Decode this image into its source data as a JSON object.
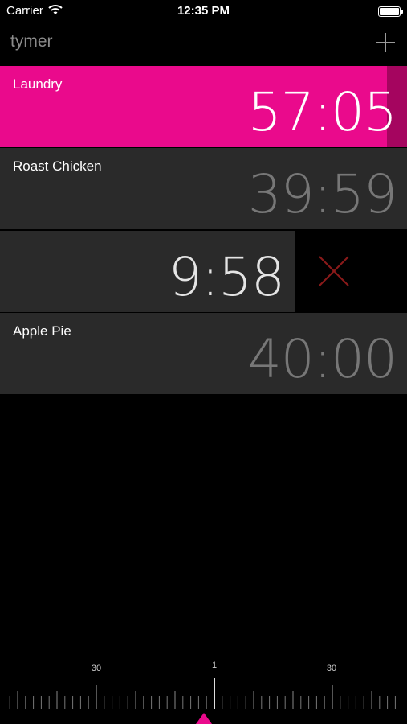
{
  "status_bar": {
    "carrier": "Carrier",
    "time": "12:35 PM"
  },
  "nav": {
    "title": "tymer"
  },
  "timers": [
    {
      "name": "Laundry",
      "time": "57:05"
    },
    {
      "name": "Roast Chicken",
      "time": "39:59"
    },
    {
      "name": "",
      "time": "9:58"
    },
    {
      "name": "Apple Pie",
      "time": "40:00"
    }
  ],
  "dial": {
    "left_label": "30",
    "center_label": "1",
    "right_label": "30"
  },
  "colors": {
    "accent": "#ea0a8c",
    "progress_dark": "#a5055f",
    "delete": "#8b1a1a",
    "row_bg": "#2a2a2a"
  },
  "icons": [
    "wifi-icon",
    "battery-icon",
    "plus-icon",
    "close-icon",
    "triangle-pointer-icon"
  ]
}
